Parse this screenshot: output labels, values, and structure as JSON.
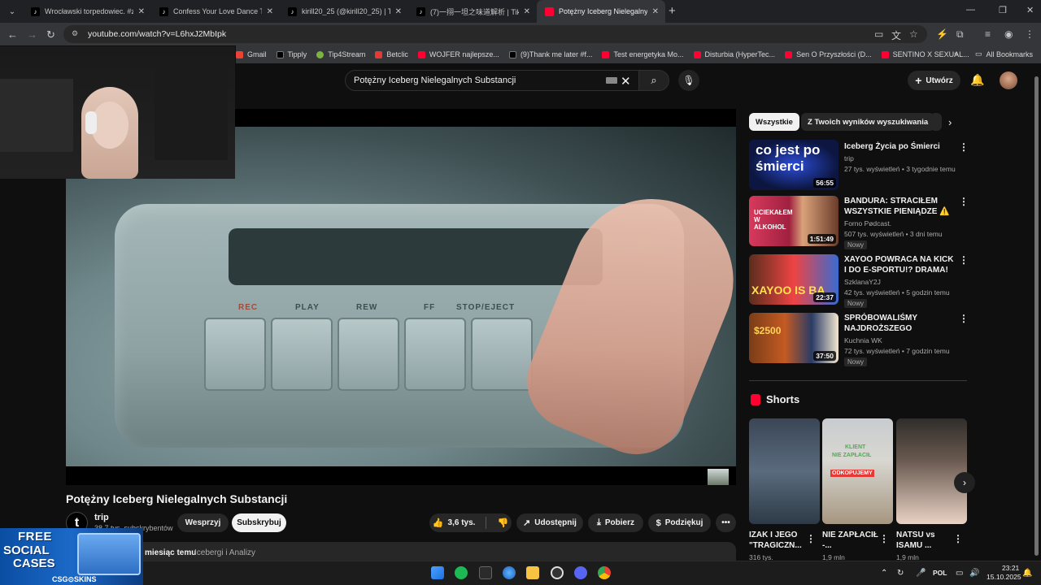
{
  "browser": {
    "tabs": [
      {
        "label": "Wrocławski torpedowiec. #zon",
        "favicon": "tiktok"
      },
      {
        "label": "Confess Your Love Dance Tutor",
        "favicon": "tiktok"
      },
      {
        "label": "kirill20_25 (@kirill20_25) | TikTo",
        "favicon": "tiktok"
      },
      {
        "label": "(7)一挧一坦之味道解析 | TikTok",
        "favicon": "tiktok"
      },
      {
        "label": "Potężny Iceberg Nielegalnych S",
        "favicon": "youtube",
        "active": true
      }
    ],
    "url": "youtube.com/watch?v=L6hxJ2MbIpk",
    "bookmarks": [
      {
        "label": "Gmail",
        "favicon": "gmail"
      },
      {
        "label": "Tipply",
        "favicon": "tipply"
      },
      {
        "label": "Tip4Stream",
        "favicon": "tip4stream"
      },
      {
        "label": "Betclic",
        "favicon": "betclic"
      },
      {
        "label": "WOJFER najlepsze...",
        "favicon": "youtube"
      },
      {
        "label": "(9)Thank me later #f...",
        "favicon": "tiktok"
      },
      {
        "label": "Test energetyka Mo...",
        "favicon": "youtube"
      },
      {
        "label": "Disturbia (HyperTec...",
        "favicon": "youtube"
      },
      {
        "label": "Sen O Przyszłości (D...",
        "favicon": "youtube"
      },
      {
        "label": "SENTINO X SEXUAL...",
        "favicon": "youtube"
      }
    ],
    "all_bookmarks": "All Bookmarks"
  },
  "youtube": {
    "search_query": "Potężny Iceberg Nielegalnych Substancji",
    "create_label": "Utwórz",
    "video": {
      "title": "Potężny Iceberg Nielegalnych Substancji",
      "deck_labels": [
        "REC",
        "PLAY",
        "REW",
        "FF",
        "STOP/EJECT"
      ],
      "channel_initial": "t",
      "channel": "trip",
      "subscribers": "38,7 tys. subskrybentów",
      "support_label": "Wesprzyj",
      "subscribe_label": "Subskrybuj",
      "likes": "3,6 tys.",
      "share_label": "Udostępnij",
      "download_label": "Pobierz",
      "thanks_label": "Podziękuj",
      "upload_date": "miesiąc temu",
      "tag": "Icebergi i Analizy"
    },
    "chips": [
      "Wszystkie",
      "Z Twoich wyników wyszukiwania"
    ],
    "recommendations": [
      {
        "thumb_text": "co jest po śmierci",
        "title": "Iceberg Życia po Śmierci",
        "channel": "trip",
        "meta": "27 tys. wyświetleń • 3 tygodnie temu",
        "duration": "56:55",
        "badge": ""
      },
      {
        "thumb_text": "UCIEKAŁEM W ALKOHOL",
        "title": "BANDURA: STRACIŁEM WSZYSTKIE PIENIĄDZE ⚠️",
        "channel": "Forno Pødcast.",
        "meta": "507 tys. wyświetleń • 3 dni temu",
        "duration": "1:51:49",
        "badge": "Nowy"
      },
      {
        "thumb_text": "XAYOO IS BA",
        "title": "XAYOO POWRACA NA KICK I DO E-SPORTU!? DRAMA! NITR...",
        "channel": "SzklanaY2J",
        "meta": "42 tys. wyświetleń • 5 godzin temu",
        "duration": "22:37",
        "badge": "Nowy"
      },
      {
        "thumb_text": "$2500",
        "title": "SPRÓBOWALIŚMY NAJDROŻSZEGO JEDZENIA W...",
        "channel": "Kuchnia WK",
        "meta": "72 tys. wyświetleń • 7 godzin temu",
        "duration": "37:50",
        "badge": "Nowy"
      }
    ],
    "shorts_heading": "Shorts",
    "shorts": [
      {
        "title": "IZAK I JEGO \"TRAGICZN...",
        "views": "316 tys."
      },
      {
        "title": "NIE ZAPŁACIŁ -...",
        "views": "1,9 mln"
      },
      {
        "title": "NATSU vs ISAMU ...",
        "views": "1,9 mln"
      }
    ],
    "short2_overlay": [
      "KLIENT",
      "NIE ZAPŁACIŁ",
      "ODKOPUJEMY"
    ]
  },
  "ad": {
    "line1": "FREE",
    "line2": "SOCIAL",
    "line3": "CASES",
    "brand": "CSG⊙SKINS"
  },
  "taskbar": {
    "language": "POL",
    "time": "23:21",
    "date": "15.10.2025"
  }
}
